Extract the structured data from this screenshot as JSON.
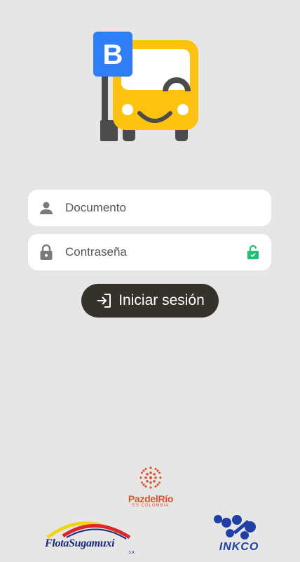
{
  "logo": {
    "badge_letter": "B",
    "icon": "bus-stop-icon",
    "colors": {
      "bus": "#fdc210",
      "badge": "#2f7ef6",
      "pole": "#4b4b4b"
    }
  },
  "login_form": {
    "document": {
      "placeholder": "Documento",
      "value": "",
      "icon": "person-icon"
    },
    "password": {
      "placeholder": "Contraseña",
      "value": "",
      "icon": "lock-icon",
      "toggle_icon": "lock-toggle-icon"
    },
    "submit": {
      "label": "Iniciar sesión",
      "icon": "login-icon"
    }
  },
  "footer": {
    "pazdelrio": {
      "name": "PazdelRío",
      "tagline": "ES COLOMBIA"
    },
    "flota": {
      "name": "FlotaSugamuxi",
      "suffix": "S.A."
    },
    "inkco": {
      "name": "INKCO"
    }
  },
  "colors": {
    "background": "#e6e6e6",
    "button": "#35322b",
    "accent_green": "#1dbf73",
    "pazdelrio": "#d9532c",
    "inkco": "#2140a6",
    "flota": "#1a2a7a"
  }
}
